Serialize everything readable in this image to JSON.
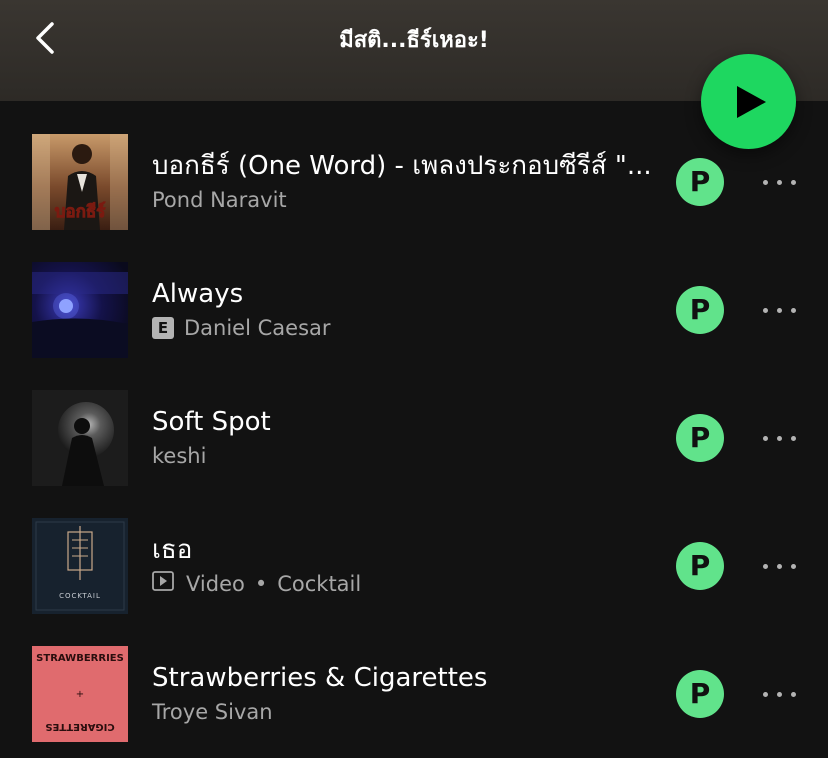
{
  "header": {
    "title": "มีสติ...ธีร์เหอะ!",
    "back_icon": "chevron-left-icon",
    "play_icon": "play-icon",
    "accent_color": "#1ed760"
  },
  "tracks": [
    {
      "title": "บอกธีร์ (One Word) - เพลงประกอบซีรีส์ \"...",
      "artist": "Pond Naravit",
      "cover_text": "บอกธีร์",
      "badge": "P"
    },
    {
      "title": "Always",
      "explicit_label": "E",
      "artist": "Daniel Caesar",
      "badge": "P"
    },
    {
      "title": "Soft Spot",
      "artist": "keshi",
      "badge": "P"
    },
    {
      "title": "เธอ",
      "video_label": "Video",
      "separator": "•",
      "artist": "Cocktail",
      "cover_text": "COCKTAIL",
      "badge": "P"
    },
    {
      "title": "Strawberries & Cigarettes",
      "artist": "Troye Sivan",
      "cover_text_top": "STRAWBERRIES",
      "cover_text_mid": "+",
      "cover_text_bottom": "CIGARETTES",
      "badge": "P"
    }
  ]
}
